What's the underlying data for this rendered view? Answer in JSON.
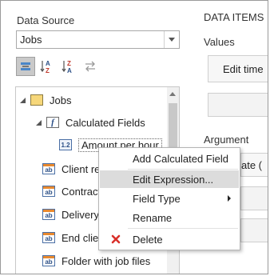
{
  "data_source": {
    "label": "Data Source",
    "selected": "Jobs"
  },
  "data_items": {
    "header": "DATA ITEMS",
    "values_label": "Values",
    "edit_button": "Edit time",
    "argument_label": "Argument",
    "argument_value": "ate ("
  },
  "tree": {
    "root": "Jobs",
    "calculated_fields": "Calculated Fields",
    "calc_field": "Amount per hour",
    "calc_icon_text": "1.2",
    "fields": [
      "Client ref",
      "Contractor",
      "Delivery n",
      "End client",
      "Folder with job files"
    ],
    "field_icon_text": "ab",
    "f_icon_text": "f"
  },
  "context_menu": {
    "items": [
      {
        "label": "Add Calculated Field"
      },
      {
        "label": "Edit Expression..."
      },
      {
        "label": "Field Type"
      },
      {
        "label": "Rename"
      },
      {
        "label": "Delete"
      }
    ]
  },
  "colors": {
    "accent": "#2b4f86",
    "highlight": "#dcdcdc",
    "delete": "#d9302a"
  }
}
